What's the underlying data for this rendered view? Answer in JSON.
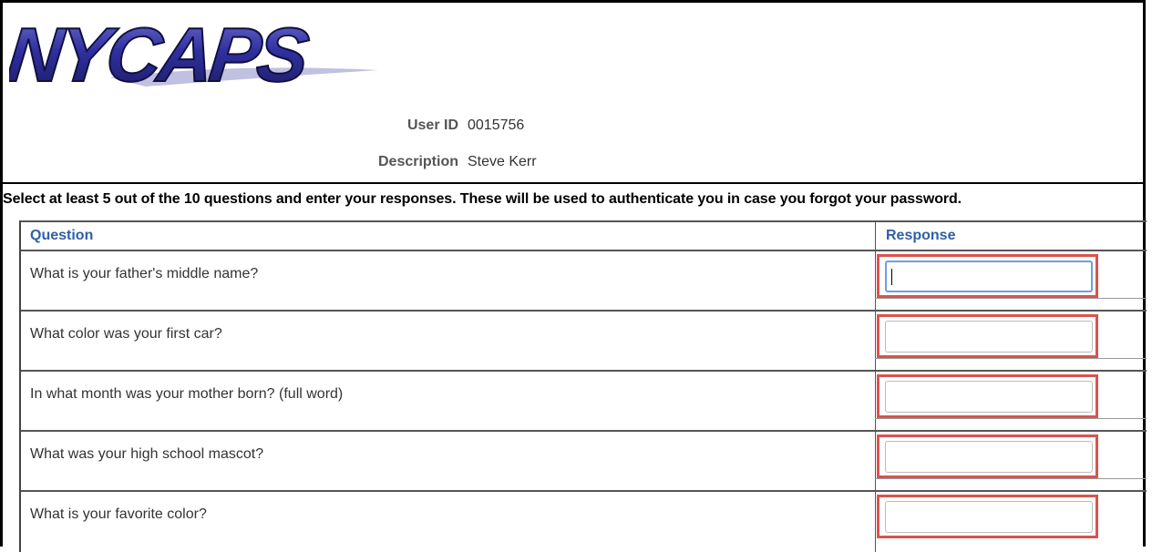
{
  "logo": {
    "text": "NYCAPS"
  },
  "user": {
    "id_label": "User ID",
    "id_value": "0015756",
    "description_label": "Description",
    "description_value": "Steve Kerr"
  },
  "instructions": "Select at least 5 out of the 10 questions and enter your responses. These will be used to authenticate you in case you forgot your password.",
  "table": {
    "header_question": "Question",
    "header_response": "Response",
    "rows": [
      {
        "question": "What is your father's middle name?",
        "response": ""
      },
      {
        "question": "What color was your first car?",
        "response": ""
      },
      {
        "question": "In what month was your mother born? (full word)",
        "response": ""
      },
      {
        "question": "What was your high school mascot?",
        "response": ""
      },
      {
        "question": "What is your favorite color?",
        "response": ""
      }
    ]
  },
  "colors": {
    "header_text": "#2f5fa8",
    "highlight_border": "#d9534f",
    "logo_fill": "#3a3aa0"
  }
}
